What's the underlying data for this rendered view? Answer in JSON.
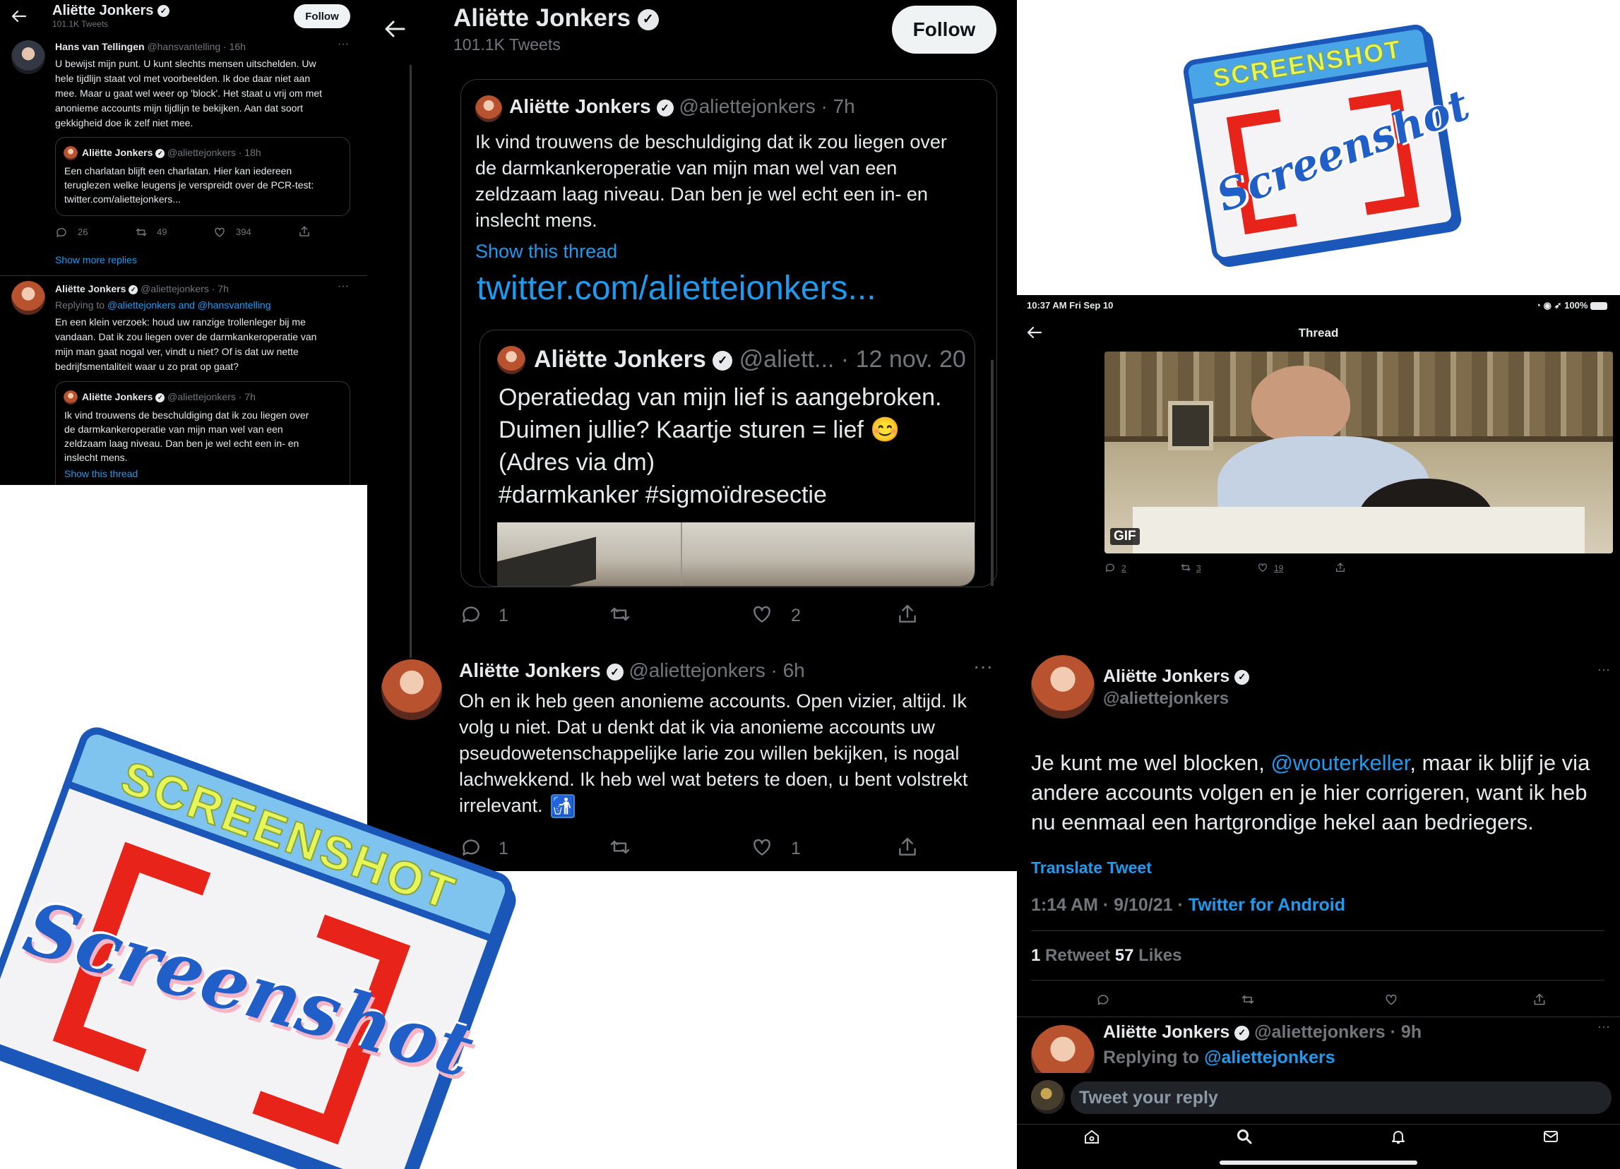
{
  "left": {
    "name": "Aliëtte Jonkers",
    "tweet_count": "101.1K Tweets",
    "follow": "Follow",
    "reply1": {
      "name": "Hans van Tellingen",
      "meta": "@hansvantelling · 16h",
      "lines": [
        "U bewijst mijn punt. U kunt slechts mensen uitschelden. Uw",
        "hele tijdlijn staat vol met voorbeelden. Ik doe daar niet aan",
        "mee. Maar u gaat wel weer op 'block'. Het staat u vrij om met",
        "anonieme accounts mijn tijdlijn te bekijken. Aan dat soort",
        "gekkigheid doe ik zelf niet mee."
      ],
      "quote_name": "Aliëtte Jonkers",
      "quote_meta": "@aliettejonkers · 18h",
      "quote_lines": [
        "Een charlatan blijft een charlatan. Hier kan iedereen",
        "teruglezen welke leugens je verspreidt over de PCR-test:",
        "twitter.com/aliettejonkers..."
      ],
      "replies": "26",
      "retweets": "49",
      "likes": "394"
    },
    "show_more": "Show more replies",
    "reply2": {
      "name": "Aliëtte Jonkers",
      "meta": "@aliettejonkers · 7h",
      "replying_to": "Replying to",
      "replying_handles": "@aliettejonkers and @hansvantelling",
      "lines": [
        "En een klein verzoek: houd uw ranzige trollenleger bij me",
        "vandaan. Dat ik zou liegen over de darmkankeroperatie van",
        "mijn man gaat nogal ver, vindt u niet? Of is dat uw nette",
        "bedrijfsmentaliteit waar u zo prat op gaat?"
      ],
      "quote_name": "Aliëtte Jonkers",
      "quote_meta": "@aliettejonkers · 7h",
      "quote_lines": [
        "Ik vind trouwens de beschuldiging dat ik zou liegen over",
        "de darmkankeroperatie van mijn man wel van een",
        "zeldzaam laag niveau. Dan ben je wel echt een in- en",
        "inslecht mens."
      ],
      "show_thread": "Show this thread"
    }
  },
  "middle": {
    "name": "Aliëtte Jonkers",
    "tweet_count": "101.1K Tweets",
    "follow": "Follow",
    "quote": {
      "name": "Aliëtte Jonkers",
      "meta": "@aliettejonkers · 7h",
      "lines": [
        "Ik vind trouwens de beschuldiging dat ik zou liegen over",
        "de darmkankeroperatie van mijn man wel van een",
        "zeldzaam laag niveau. Dan ben je wel echt een in- en",
        "inslecht mens."
      ],
      "show_thread": "Show this thread",
      "link": "twitter.com/aliettejonkers...",
      "inner_name": "Aliëtte Jonkers",
      "inner_handle": "@aliett...",
      "inner_date": "· 12 nov. 20",
      "inner_lines": [
        "Operatiedag van mijn lief is aangebroken.",
        "Duimen jullie? Kaartje sturen = lief 😊",
        "(Adres via dm)",
        "#darmkanker #sigmoïdresectie"
      ]
    },
    "actions1": {
      "replies": "1",
      "likes": "2"
    },
    "tweet": {
      "name": "Aliëtte Jonkers",
      "meta": "@aliettejonkers · 6h",
      "lines": [
        "Oh en ik heb geen anonieme accounts. Open vizier, altijd. Ik",
        "volg u niet. Dat u denkt dat ik via anonieme accounts uw",
        "pseudowetenschappelijke larie zou willen bekijken, is nogal",
        "lachwekkend. Ik heb wel wat beters te doen, u bent volstrekt",
        "irrelevant."
      ],
      "emoji": "🚮"
    },
    "actions2": {
      "replies": "1",
      "likes": "1"
    }
  },
  "right": {
    "status_time": "10:37 AM   Fri Sep 10",
    "status_right": "100%",
    "header": "Thread",
    "gif_label": "GIF",
    "gif_actions": {
      "replies": "2",
      "retweets": "3",
      "likes": "19"
    },
    "name": "Aliëtte Jonkers",
    "handle": "@aliettejonkers",
    "text_before": "Je kunt me wel blocken, ",
    "mention": "@wouterkeller",
    "text_line1_after": ", maar ik blijf je via",
    "text_line2": "andere accounts volgen en je hier corrigeren, want ik heb",
    "text_line3": "nu eenmaal een hartgrondige hekel aan bedriegers.",
    "translate": "Translate Tweet",
    "timestamp": "1:14 AM · 9/10/21 · ",
    "client": "Twitter for Android",
    "retweet_count": "1",
    "retweet_label": "Retweet",
    "like_count": "57",
    "like_label": "Likes",
    "reply_name": "Aliëtte Jonkers",
    "reply_meta": "@aliettejonkers · 9h",
    "replying_to": "Replying to",
    "replying_handle": "@aliettejonkers",
    "compose_placeholder": "Tweet your reply"
  },
  "stickers": {
    "top_banner": "SCREENSHOT",
    "top_script": "Screenshot",
    "bottom_banner": "SCREENSHOT",
    "bottom_script": "Screenshot"
  },
  "colors": {
    "accent": "#1d9bf0",
    "bg": "#000000",
    "sticker_red": "#e8231a",
    "sticker_yellow": "#e6f55a",
    "sticker_blue": "#1a57b8"
  }
}
